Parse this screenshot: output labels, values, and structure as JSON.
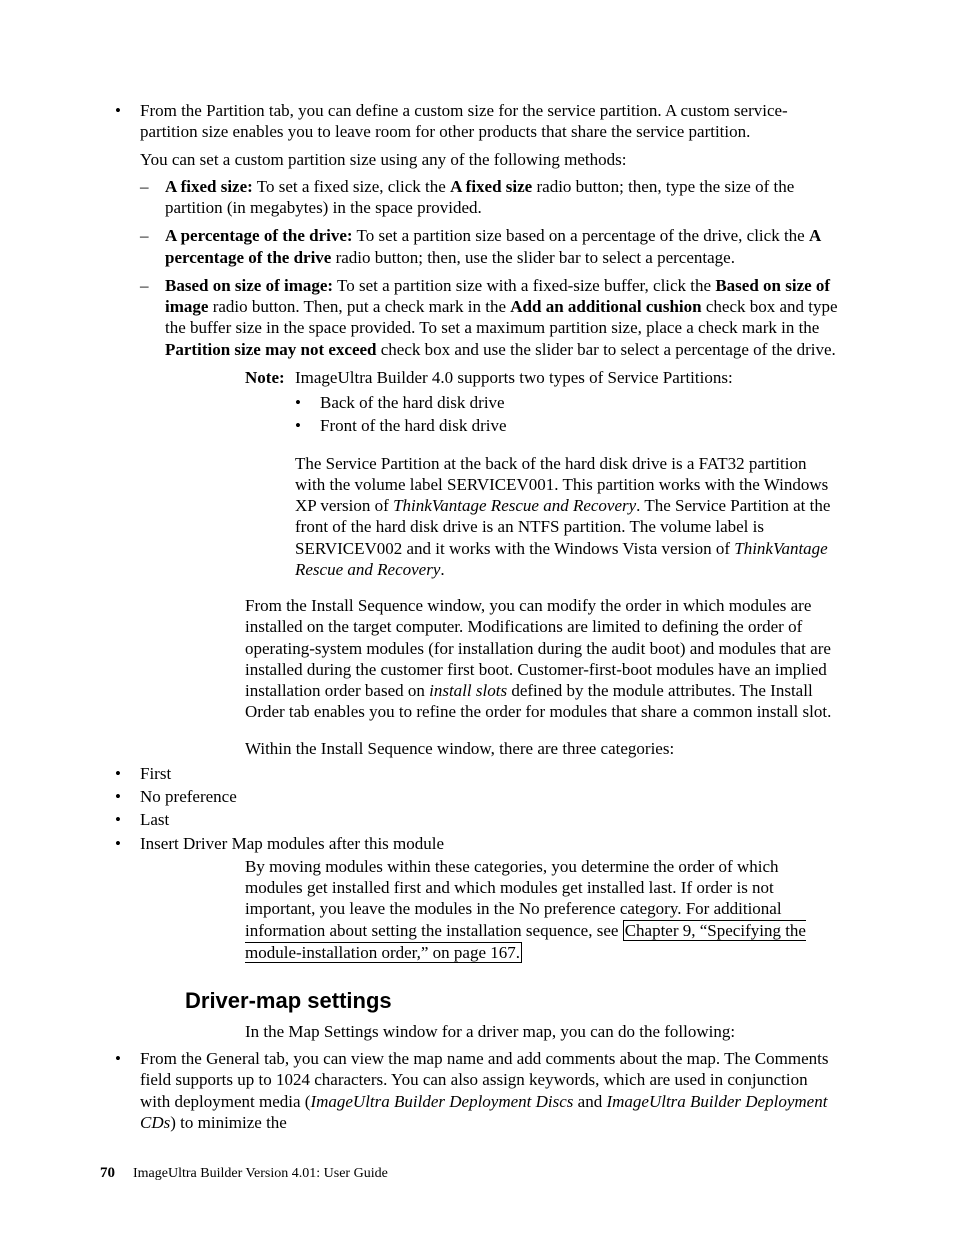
{
  "top_bullet": {
    "intro": "From the Partition tab, you can define a custom size for the service partition. A custom service-partition size enables you to leave room for other products that share the service partition.",
    "lead": "You can set a custom partition size using any of the following methods:",
    "items": [
      {
        "label": "A fixed size:",
        "body_pre": " To set a fixed size, click the ",
        "strong1": "A fixed size",
        "body_post": " radio button; then, type the size of the partition (in megabytes) in the space provided."
      },
      {
        "label": "A percentage of the drive:",
        "body_pre": " To set a partition size based on a percentage of the drive, click the ",
        "strong1": "A percentage of the drive",
        "body_post": " radio button; then, use the slider bar to select a percentage."
      },
      {
        "label": "Based on size of image:",
        "body_pre": " To set a partition size with a fixed-size buffer, click the ",
        "strong1": "Based on size of image",
        "mid1": " radio button. Then, put a check mark in the ",
        "strong2": "Add an additional cushion",
        "mid2": " check box and type the buffer size in the space provided. To set a maximum partition size, place a check mark in the ",
        "strong3": "Partition size may not exceed",
        "body_post": " check box and use the slider bar to select a percentage of the drive."
      }
    ]
  },
  "note": {
    "label": "Note:",
    "line": "ImageUltra Builder 4.0 supports two types of Service Partitions:",
    "bullets": [
      "Back of the hard disk drive",
      "Front of the hard disk drive"
    ],
    "para_pre": "The Service Partition at the back of the hard disk drive is a FAT32 partition with the volume label SERVICEV001. This partition works with the Windows XP version of ",
    "ital1": "ThinkVantage Rescue and Recovery",
    "mid": ". The Service Partition at the front of the hard disk drive is an NTFS partition. The volume label is SERVICEV002 and it works with the Windows Vista version of ",
    "ital2": "ThinkVantage Rescue and Recovery",
    "post": "."
  },
  "install_seq": {
    "p1_pre": "From the Install Sequence window, you can modify the order in which modules are installed on the target computer. Modifications are limited to defining the order of operating-system modules (for installation during the audit boot) and modules that are installed during the customer first boot. Customer-first-boot modules have an implied installation order based on ",
    "p1_ital": "install slots",
    "p1_post": " defined by the module attributes. The Install Order tab enables you to refine the order for modules that share a common install slot.",
    "p2": "Within the Install Sequence window, there are three categories:",
    "cats": [
      "First",
      "No preference",
      "Last",
      "Insert Driver Map modules after this module"
    ],
    "p3_pre": "By moving modules within these categories, you determine the order of which modules get installed first and which modules get installed last. If order is not important, you leave the modules in the No preference category. For additional information about setting the installation sequence, see ",
    "xref": "Chapter 9, “Specifying the module-installation order,” on page 167."
  },
  "section_heading": "Driver-map settings",
  "driver_map": {
    "intro": "In the Map Settings window for a driver map, you can do the following:",
    "b1_pre": "From the General tab, you can view the map name and add comments about the map. The Comments field supports up to 1024 characters. You can also assign keywords, which are used in conjunction with deployment media (",
    "b1_i1": "ImageUltra Builder Deployment Discs",
    "b1_mid": " and ",
    "b1_i2": "ImageUltra Builder Deployment CDs",
    "b1_post": ") to minimize the"
  },
  "footer": {
    "page": "70",
    "title": "ImageUltra Builder Version 4.01:  User Guide"
  }
}
